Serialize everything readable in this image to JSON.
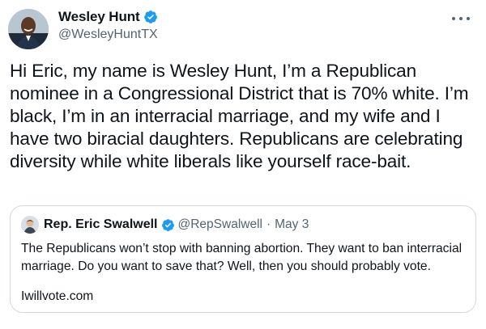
{
  "tweet": {
    "author_name": "Wesley Hunt",
    "author_handle": "@WesleyHuntTX",
    "avatar_icon": "profile-photo",
    "verified_icon": "verified-badge-icon",
    "more_icon": "more-options-icon",
    "text": "Hi Eric, my name is Wesley Hunt, I’m a Republican nominee in a Congressional District that is 70% white. I’m black, I’m in an interracial marriage, and my wife and I have two biracial daughters. Republicans are celebrating diversity while white liberals like yourself race-bait."
  },
  "quote": {
    "author_name": "Rep. Eric Swalwell",
    "author_handle": "@RepSwalwell",
    "separator": "·",
    "date": "May 3",
    "text": "The Republicans won’t stop with banning abortion. They want to ban interracial marriage. Do you want to save that? Well, then you should probably vote.",
    "link": "Iwillvote.com"
  },
  "colors": {
    "verified_blue": "#1d9bf0",
    "secondary_text": "#536471",
    "border": "#cfd9de"
  }
}
